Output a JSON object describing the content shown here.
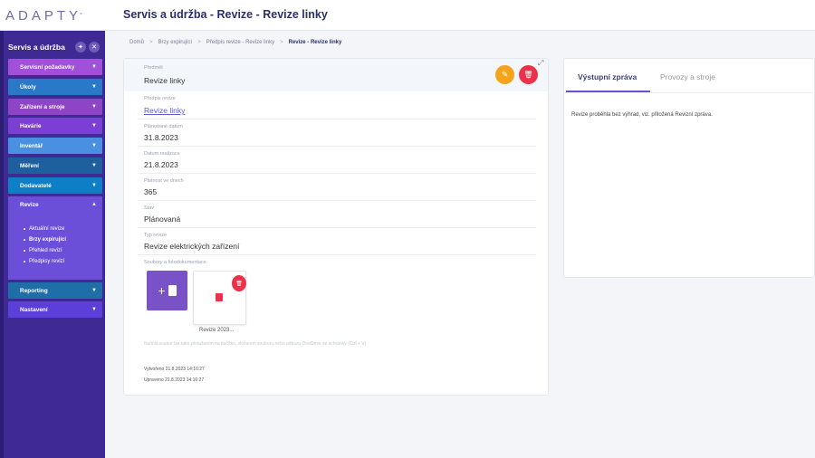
{
  "app": {
    "logo": "ADAPTY",
    "logo_mark": "°"
  },
  "header": {
    "title": "Servis a údržba - Revize - Revize linky"
  },
  "sidebar": {
    "title": "Servis a údržba",
    "items": [
      {
        "label": "Servisní požadavky",
        "color": "#a24fd9"
      },
      {
        "label": "Úkoly",
        "color": "#2a78c8"
      },
      {
        "label": "Zařízení a stroje",
        "color": "#8e44c7"
      },
      {
        "label": "Havárie",
        "color": "#7b3fd6"
      },
      {
        "label": "Inventář",
        "color": "#4a90e2"
      },
      {
        "label": "Měření",
        "color": "#1e5f9e"
      },
      {
        "label": "Dodavatelé",
        "color": "#0d7fc7"
      },
      {
        "label": "Revize",
        "color": "#6b4fd9"
      },
      {
        "label": "Reporting",
        "color": "#1e6fa8"
      },
      {
        "label": "Nastavení",
        "color": "#5a3fd9"
      }
    ],
    "sub_items": [
      {
        "label": "Aktuální revize"
      },
      {
        "label": "Brzy expirující"
      },
      {
        "label": "Přehled revizí"
      },
      {
        "label": "Předpisy revizí"
      }
    ]
  },
  "breadcrumb": [
    "Domů",
    "Brzy expirující",
    "Předpis revize - Revize linky",
    "Revize - Revize linky"
  ],
  "detail": {
    "subject_label": "Předmět",
    "subject_value": "Revize linky",
    "prescription_label": "Předpis revize",
    "prescription_value": "Revize linky",
    "planned_label": "Plánované datum",
    "planned_value": "31.8.2023",
    "realized_label": "Datum realizace",
    "realized_value": "21.8.2023",
    "validity_label": "Platnost ve dnech",
    "validity_value": "365",
    "state_label": "Stav",
    "state_value": "Plánovaná",
    "type_label": "Typ revize",
    "type_value": "Revize elektrických zařízení",
    "files_label": "Soubory a fotodokumentace",
    "file_name": "Revize 2023...",
    "hint": "Nahrát soubor lze také přetažením na tlačítko, vložením souboru nebo odkazu OneDrive ze schránky (Ctrl + V)",
    "created": "Vytvořeno 21.8.2023 14:16:27",
    "updated": "Upraveno 21.8.2023 14:16:27"
  },
  "right_panel": {
    "tabs": [
      "Výstupní zpráva",
      "Provozy a stroje"
    ],
    "report": "Revize proběhla bez výhrad, viz. přiložená Revizní zpráva."
  },
  "colors": {
    "accent": "#6b4fd9",
    "edit": "#f5a31a",
    "delete": "#e8334a",
    "sidebar": "#3f2a93"
  }
}
